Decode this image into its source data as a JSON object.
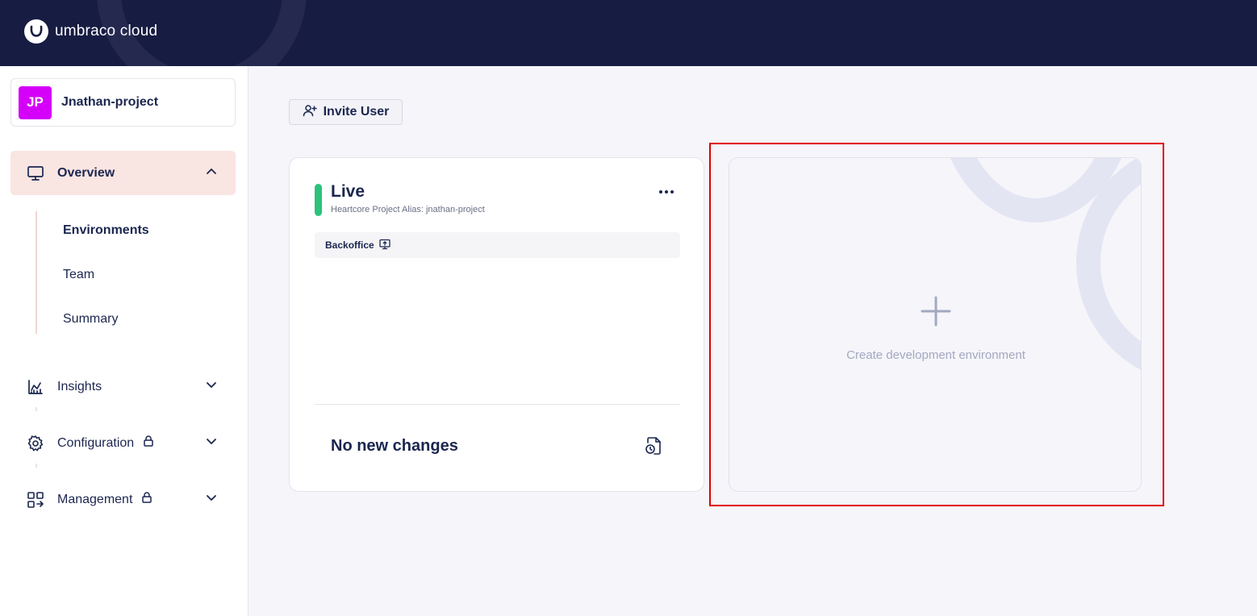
{
  "header": {
    "brand_text": "umbraco cloud",
    "logo_icon": "umbraco-logo-icon"
  },
  "sidebar": {
    "project": {
      "initials": "JP",
      "name": "Jnathan-project",
      "avatar_color": "#d500f9"
    },
    "nav": {
      "overview": {
        "label": "Overview",
        "icon": "monitor-icon",
        "expanded": true
      },
      "insights": {
        "label": "Insights",
        "icon": "chart-icon"
      },
      "configuration": {
        "label": "Configuration",
        "icon": "gear-icon",
        "locked": true
      },
      "management": {
        "label": "Management",
        "icon": "management-icon",
        "locked": true
      }
    },
    "subnav": [
      "Environments",
      "Team",
      "Summary"
    ],
    "active_subitem": "Environments"
  },
  "main": {
    "invite_button": "Invite User",
    "env_card": {
      "name": "Live",
      "alias": "Heartcore Project Alias: jnathan-project",
      "status_color": "#2bc37c",
      "backoffice_label": "Backoffice",
      "changes_label": "No new changes"
    },
    "create_card": {
      "label": "Create development environment"
    }
  }
}
